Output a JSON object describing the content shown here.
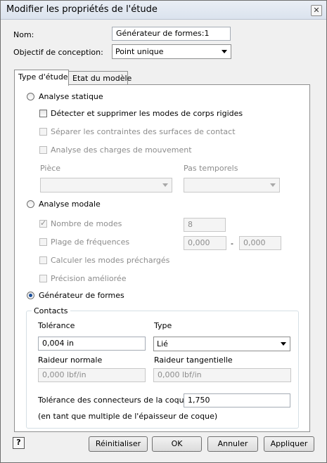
{
  "window": {
    "title": "Modifier les propriétés de l'étude"
  },
  "form": {
    "name_label": "Nom:",
    "name_value": "Générateur de formes:1",
    "objective_label": "Objectif de conception:",
    "objective_value": "Point unique"
  },
  "tabs": [
    {
      "label": "Type d'étude",
      "active": true
    },
    {
      "label": "Etat du modèle",
      "active": false
    }
  ],
  "study": {
    "static_label": "Analyse statique",
    "static_opts": {
      "rigid": "Détecter et supprimer les modes de corps rigides",
      "separate": "Séparer les contraintes des surfaces de contact",
      "motion": "Analyse des charges de mouvement"
    },
    "piece_label": "Pièce",
    "time_steps_label": "Pas temporels",
    "modal_label": "Analyse modale",
    "modal_opts": {
      "num_modes_label": "Nombre de modes",
      "num_modes_value": "8",
      "freq_range_label": "Plage de fréquences",
      "freq_min": "0,000",
      "freq_sep": "-",
      "freq_max": "0,000",
      "preloaded": "Calculer les modes préchargés",
      "precision": "Précision améliorée"
    },
    "shape_label": "Générateur de formes",
    "selected": "shape"
  },
  "contacts": {
    "title": "Contacts",
    "tolerance_label": "Tolérance",
    "tolerance_value": "0,004 in",
    "type_label": "Type",
    "type_value": "Lié",
    "normal_label": "Raideur normale",
    "normal_placeholder": "0,000 lbf/in",
    "tangent_label": "Raideur tangentielle",
    "tangent_placeholder": "0,000 lbf/in",
    "shell_label": "Tolérance des connecteurs de la coque",
    "shell_value": "1,750",
    "shell_note": "(en tant que multiple de l'épaisseur de coque)"
  },
  "buttons": {
    "help": "?",
    "reset": "Réinitialiser",
    "ok": "OK",
    "cancel": "Annuler",
    "apply": "Appliquer"
  },
  "icons": {
    "close": "close-icon",
    "help": "help-icon",
    "dropdown": "chevron-down-icon"
  }
}
